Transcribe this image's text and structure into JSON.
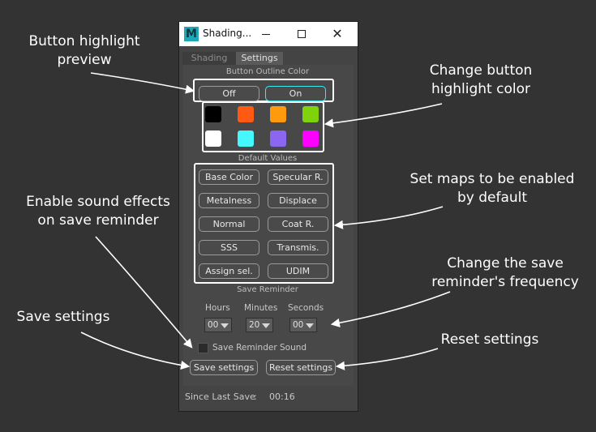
{
  "window": {
    "title": "Shading...",
    "app_icon_letter": "M"
  },
  "tabs": [
    {
      "label": "Shading",
      "active": false
    },
    {
      "label": "Settings",
      "active": true
    }
  ],
  "outline_color": {
    "header": "Button Outline Color",
    "off_label": "Off",
    "on_label": "On",
    "selected": "On",
    "swatches": [
      "#000000",
      "#ff5a14",
      "#ff9a0e",
      "#7ed30c",
      "#ffffff",
      "#45f8ff",
      "#8c66f0",
      "#ff00ff"
    ]
  },
  "default_values": {
    "header": "Default Values",
    "buttons": [
      "Base Color",
      "Specular R.",
      "Metalness",
      "Displace",
      "Normal",
      "Coat R.",
      "SSS",
      "Transmis.",
      "Assign sel.",
      "UDIM"
    ]
  },
  "save_reminder": {
    "header": "Save Reminder",
    "hours_label": "Hours",
    "minutes_label": "Minutes",
    "seconds_label": "Seconds",
    "hours_value": "00",
    "minutes_value": "20",
    "seconds_value": "00",
    "sound_label": "Save Reminder Sound",
    "sound_checked": false
  },
  "actions": {
    "save_label": "Save settings",
    "reset_label": "Reset settings"
  },
  "status": {
    "label": "Since Last Save",
    "separator": ":",
    "value": "00:16"
  },
  "annotations": {
    "highlight_preview": [
      "Button highlight",
      "preview"
    ],
    "change_color": [
      "Change button",
      "highlight color"
    ],
    "maps_default": [
      "Set maps to be enabled",
      "by default"
    ],
    "sound_effects": [
      "Enable sound effects",
      "on save reminder"
    ],
    "frequency": [
      "Change the save",
      "reminder's frequency"
    ],
    "save_settings": "Save settings",
    "reset_settings": "Reset settings"
  },
  "colors": {
    "background": "#333333",
    "on_accent": "#3ee8ef",
    "annotation": "#ffffff"
  }
}
